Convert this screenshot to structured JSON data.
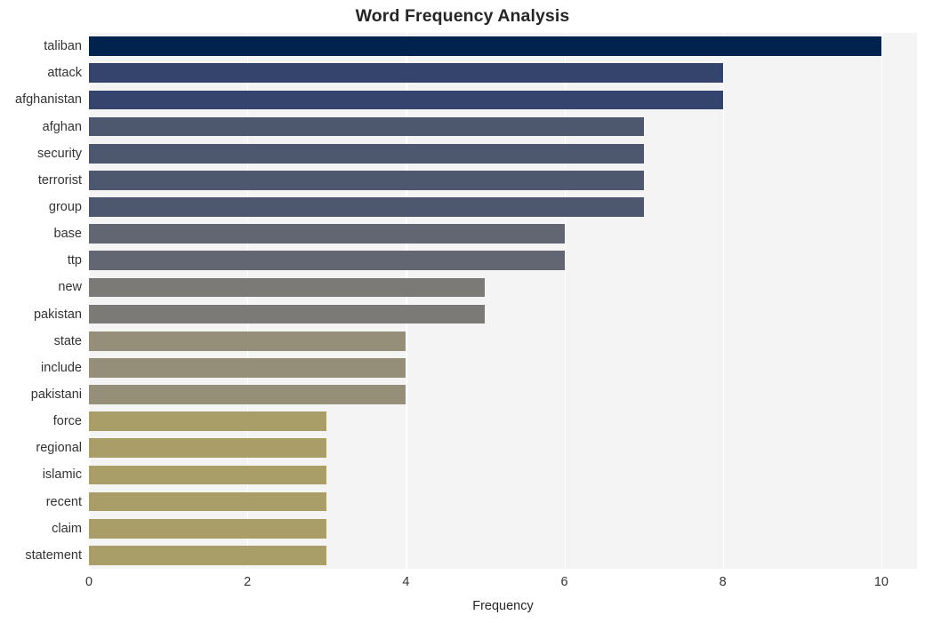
{
  "chart_data": {
    "type": "bar",
    "orientation": "horizontal",
    "title": "Word Frequency Analysis",
    "xlabel": "Frequency",
    "ylabel": "",
    "xlim": [
      0,
      10.45
    ],
    "xticks": [
      0,
      2,
      4,
      6,
      8,
      10
    ],
    "xtick_labels": [
      "0",
      "2",
      "4",
      "6",
      "8",
      "10"
    ],
    "grid": "vertical-only",
    "legend": "none",
    "categories": [
      "taliban",
      "attack",
      "afghanistan",
      "afghan",
      "security",
      "terrorist",
      "group",
      "base",
      "ttp",
      "new",
      "pakistan",
      "state",
      "include",
      "pakistani",
      "force",
      "regional",
      "islamic",
      "recent",
      "claim",
      "statement"
    ],
    "values": [
      10,
      8,
      8,
      7,
      7,
      7,
      7,
      6,
      6,
      5,
      5,
      4,
      4,
      4,
      3,
      3,
      3,
      3,
      3,
      3
    ],
    "bar_colors": [
      "#00234d",
      "#35446c",
      "#35446c",
      "#4d586e",
      "#4d586e",
      "#4d586e",
      "#4d586e",
      "#626672",
      "#626672",
      "#7b7a76",
      "#7b7a76",
      "#958e78",
      "#958e78",
      "#958e78",
      "#aa9e68",
      "#aa9e68",
      "#aa9e68",
      "#aa9e68",
      "#aa9e68",
      "#aa9e68"
    ],
    "plot_background": "#f4f4f5",
    "gridline_color": "#ffffff",
    "figure_background": "#ffffff"
  }
}
